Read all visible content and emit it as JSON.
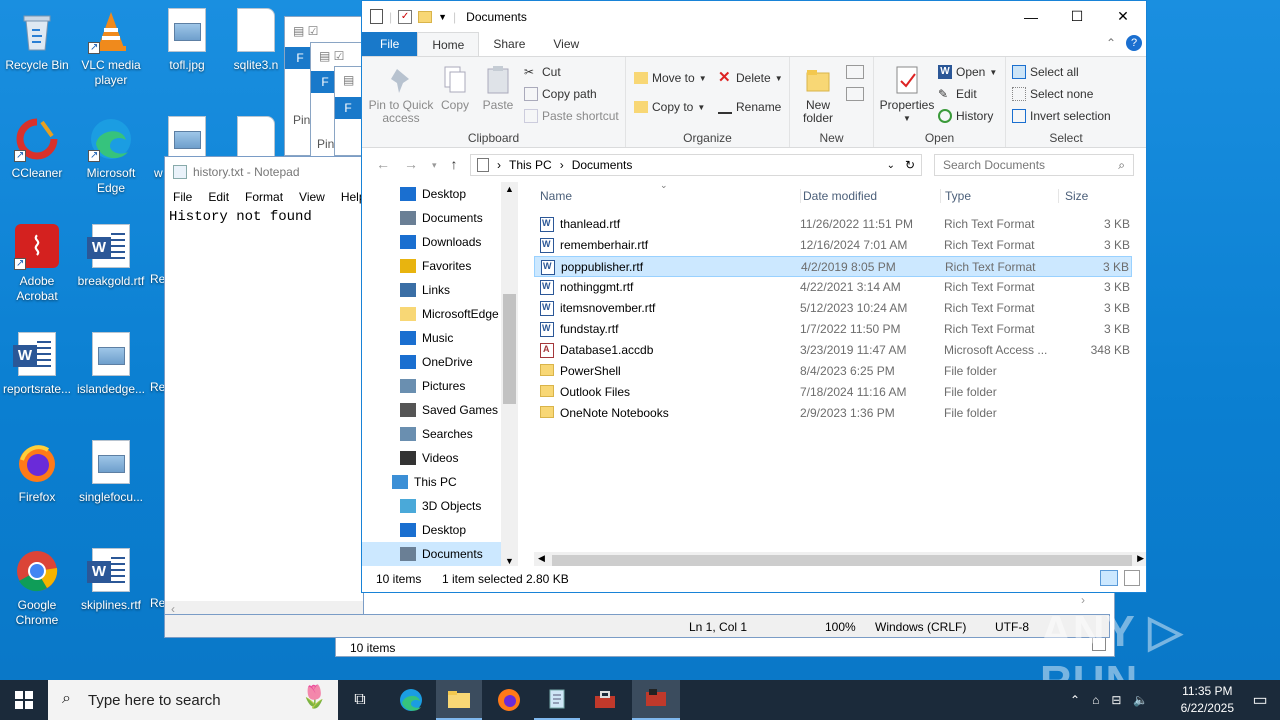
{
  "desktop": {
    "icons": [
      {
        "label": "Recycle Bin"
      },
      {
        "label": "VLC media player"
      },
      {
        "label": "tofl.jpg"
      },
      {
        "label": "sqlite3.n"
      },
      {
        "label": "CCleaner"
      },
      {
        "label": "Microsoft Edge"
      },
      {
        "label": "w"
      },
      {
        "label": "Adobe Acrobat"
      },
      {
        "label": "breakgold.rtf"
      },
      {
        "label": "Re"
      },
      {
        "label": "reportsrate..."
      },
      {
        "label": "islandedge..."
      },
      {
        "label": "Re"
      },
      {
        "label": "Firefox"
      },
      {
        "label": "singlefocu..."
      },
      {
        "label": "Google Chrome"
      },
      {
        "label": "skiplines.rtf"
      },
      {
        "label": "Re"
      }
    ],
    "bg_fragments": {
      "pin1": "Pin",
      "pin2": "Pin",
      "f1": "F",
      "f2": "F",
      "f3": "F"
    }
  },
  "notepad": {
    "title": "history.txt - Notepad",
    "menu": [
      "File",
      "Edit",
      "Format",
      "View",
      "Help"
    ],
    "content": "History not found",
    "status": {
      "position": "Ln 1, Col 1",
      "zoom": "100%",
      "eol": "Windows (CRLF)",
      "encoding": "UTF-8"
    }
  },
  "explorer": {
    "title": "Documents",
    "tabs": [
      "File",
      "Home",
      "Share",
      "View"
    ],
    "ribbon": {
      "clipboard": {
        "pin": "Pin to Quick access",
        "copy": "Copy",
        "paste": "Paste",
        "cut": "Cut",
        "copy_path": "Copy path",
        "paste_shortcut": "Paste shortcut",
        "group": "Clipboard"
      },
      "organize": {
        "move_to": "Move to",
        "copy_to": "Copy to",
        "delete": "Delete",
        "rename": "Rename",
        "group": "Organize"
      },
      "new": {
        "new_folder": "New folder",
        "group": "New"
      },
      "open": {
        "properties": "Properties",
        "open": "Open",
        "edit": "Edit",
        "history": "History",
        "group": "Open"
      },
      "select": {
        "select_all": "Select all",
        "select_none": "Select none",
        "invert": "Invert selection",
        "group": "Select"
      }
    },
    "address": {
      "path": [
        "This PC",
        "Documents"
      ],
      "search_placeholder": "Search Documents"
    },
    "nav": [
      {
        "label": "Desktop"
      },
      {
        "label": "Documents"
      },
      {
        "label": "Downloads"
      },
      {
        "label": "Favorites"
      },
      {
        "label": "Links"
      },
      {
        "label": "MicrosoftEdge"
      },
      {
        "label": "Music"
      },
      {
        "label": "OneDrive"
      },
      {
        "label": "Pictures"
      },
      {
        "label": "Saved Games"
      },
      {
        "label": "Searches"
      },
      {
        "label": "Videos"
      },
      {
        "label": "This PC"
      },
      {
        "label": "3D Objects"
      },
      {
        "label": "Desktop"
      },
      {
        "label": "Documents"
      }
    ],
    "columns": {
      "name": "Name",
      "date": "Date modified",
      "type": "Type",
      "size": "Size"
    },
    "files": [
      {
        "name": "thanlead.rtf",
        "date": "11/26/2022 11:51 PM",
        "type": "Rich Text Format",
        "size": "3 KB",
        "kind": "word"
      },
      {
        "name": "rememberhair.rtf",
        "date": "12/16/2024 7:01 AM",
        "type": "Rich Text Format",
        "size": "3 KB",
        "kind": "word"
      },
      {
        "name": "poppublisher.rtf",
        "date": "4/2/2019 8:05 PM",
        "type": "Rich Text Format",
        "size": "3 KB",
        "kind": "word",
        "selected": true
      },
      {
        "name": "nothinggmt.rtf",
        "date": "4/22/2021 3:14 AM",
        "type": "Rich Text Format",
        "size": "3 KB",
        "kind": "word"
      },
      {
        "name": "itemsnovember.rtf",
        "date": "5/12/2023 10:24 AM",
        "type": "Rich Text Format",
        "size": "3 KB",
        "kind": "word"
      },
      {
        "name": "fundstay.rtf",
        "date": "1/7/2022 11:50 PM",
        "type": "Rich Text Format",
        "size": "3 KB",
        "kind": "word"
      },
      {
        "name": "Database1.accdb",
        "date": "3/23/2019 11:47 AM",
        "type": "Microsoft Access ...",
        "size": "348 KB",
        "kind": "access"
      },
      {
        "name": "PowerShell",
        "date": "8/4/2023 6:25 PM",
        "type": "File folder",
        "size": "",
        "kind": "folder"
      },
      {
        "name": "Outlook Files",
        "date": "7/18/2024 11:16 AM",
        "type": "File folder",
        "size": "",
        "kind": "folder"
      },
      {
        "name": "OneNote Notebooks",
        "date": "2/9/2023 1:36 PM",
        "type": "File folder",
        "size": "",
        "kind": "folder"
      }
    ],
    "status": {
      "count": "10 items",
      "selected": "1 item selected",
      "size": "2.80 KB"
    }
  },
  "bg_explorer": {
    "status": "10 items"
  },
  "taskbar": {
    "search_placeholder": "Type here to search",
    "time": "11:35 PM",
    "date": "6/22/2025"
  },
  "watermark": "ANY RUN"
}
